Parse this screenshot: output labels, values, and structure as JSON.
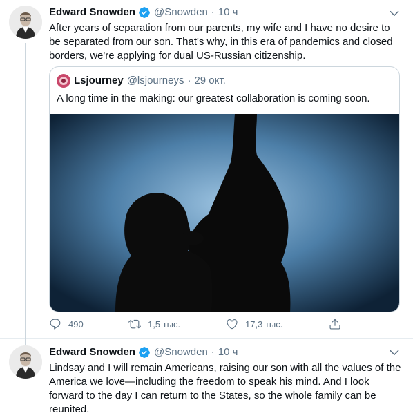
{
  "tweet1": {
    "author_name": "Edward Snowden",
    "handle": "@Snowden",
    "separator": "·",
    "time": "10 ч",
    "text_lines": [
      "After years of separation from our parents, my wife and I have no desire to",
      "be separated from our son. That's why, in this era of pandemics and closed",
      "borders, we're applying for dual US-Russian citizenship."
    ],
    "quote": {
      "author_name": "Lsjourney",
      "handle": "@lsjourneys",
      "separator": "·",
      "time": "29 окт.",
      "text": "A long time in the making: our greatest collaboration is coming soon."
    },
    "actions": {
      "reply_count": "490",
      "retweet_count": "1,5 тыс.",
      "like_count": "17,3 тыс."
    }
  },
  "tweet2": {
    "author_name": "Edward Snowden",
    "handle": "@Snowden",
    "separator": "·",
    "time": "10 ч",
    "text_lines": [
      "Lindsay and I will remain Americans, raising our son with all the values of the",
      "America we love—including the freedom to speak his mind. And I look",
      "forward to the day I can return to the States, so the whole family can be",
      "reunited."
    ]
  },
  "colors": {
    "verified": "#1da1f2",
    "secondary_text": "#5b7083",
    "border": "#ccd6dd"
  }
}
